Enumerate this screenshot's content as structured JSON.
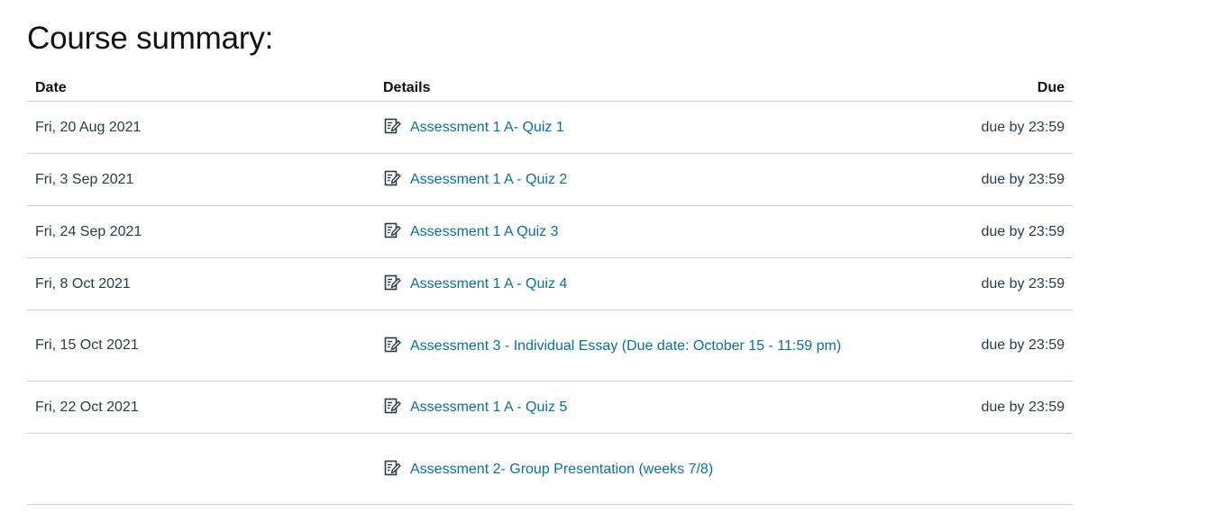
{
  "page": {
    "title": "Course summary:"
  },
  "table": {
    "headers": {
      "date": "Date",
      "details": "Details",
      "due": "Due"
    },
    "rows": [
      {
        "date": "Fri, 20 Aug 2021",
        "title": "Assessment 1 A- Quiz 1",
        "due": "due by 23:59",
        "icon": "quiz-icon"
      },
      {
        "date": "Fri, 3 Sep 2021",
        "title": "Assessment 1 A - Quiz 2",
        "due": "due by 23:59",
        "icon": "quiz-icon"
      },
      {
        "date": "Fri, 24 Sep 2021",
        "title": "Assessment 1 A Quiz 3",
        "due": "due by 23:59",
        "icon": "quiz-icon"
      },
      {
        "date": "Fri, 8 Oct 2021",
        "title": "Assessment 1 A - Quiz 4",
        "due": "due by 23:59",
        "icon": "quiz-icon"
      },
      {
        "date": "Fri, 15 Oct 2021",
        "title": "Assessment 3 - Individual Essay (Due date: October 15 - 11:59 pm)",
        "due": "due by 23:59",
        "icon": "quiz-icon"
      },
      {
        "date": "Fri, 22 Oct 2021",
        "title": "Assessment 1 A - Quiz 5",
        "due": "due by 23:59",
        "icon": "quiz-icon"
      },
      {
        "date": "",
        "title": "Assessment 2- Group Presentation (weeks 7/8)",
        "due": "",
        "icon": "quiz-icon"
      }
    ]
  },
  "colors": {
    "link": "#0770a3",
    "text": "#2d3b45",
    "divider": "#c7cdd1"
  }
}
